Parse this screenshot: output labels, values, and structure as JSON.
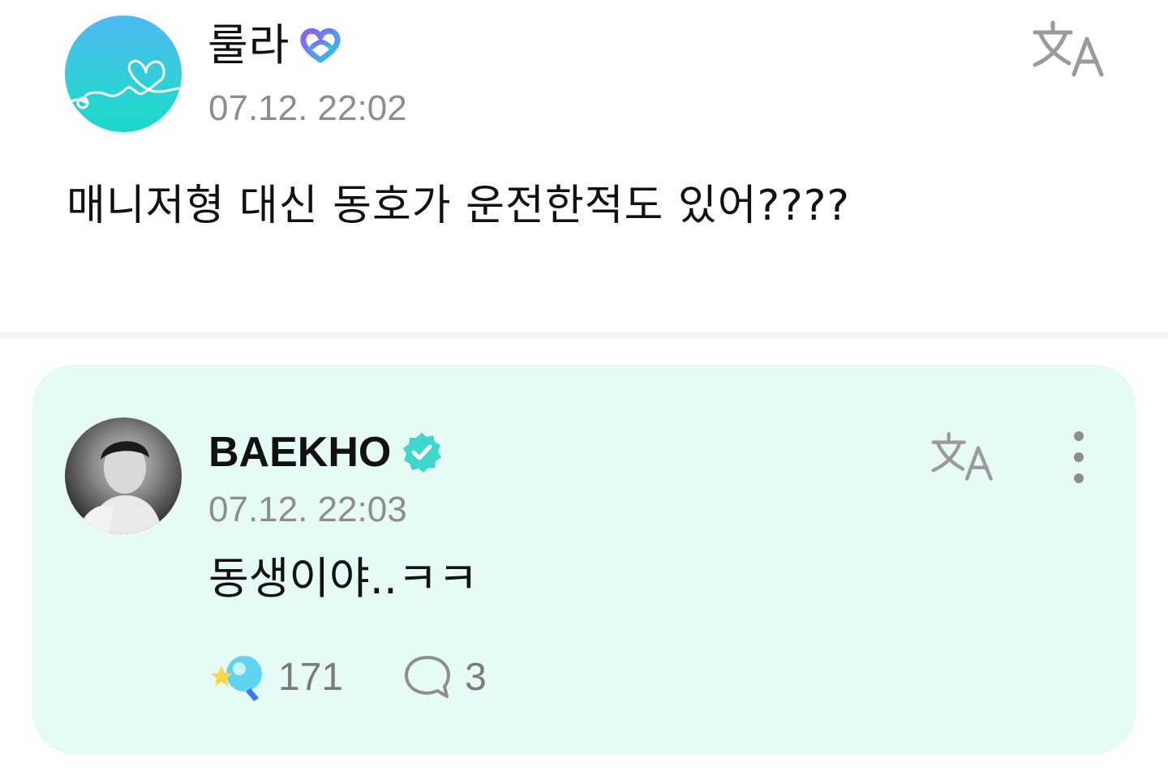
{
  "post": {
    "author_name": "룰라",
    "timestamp": "07.12. 22:02",
    "body": "매니저형 대신 동호가 운전한적도 있어????",
    "avatar_icon": "heart-line-logo-icon",
    "badge_icon": "membership-badge-icon"
  },
  "reply": {
    "author_name": "BAEKHO",
    "timestamp": "07.12. 22:03",
    "body": "동생이야..ㅋㅋ",
    "badge_icon": "verified-check-icon",
    "like_count": "171",
    "comment_count": "3"
  },
  "colors": {
    "card_background": "#e6fbf6",
    "verified": "#3fd6cc",
    "timestamp_text": "#8d8d8d",
    "icon_gray": "#9a9a9a"
  }
}
